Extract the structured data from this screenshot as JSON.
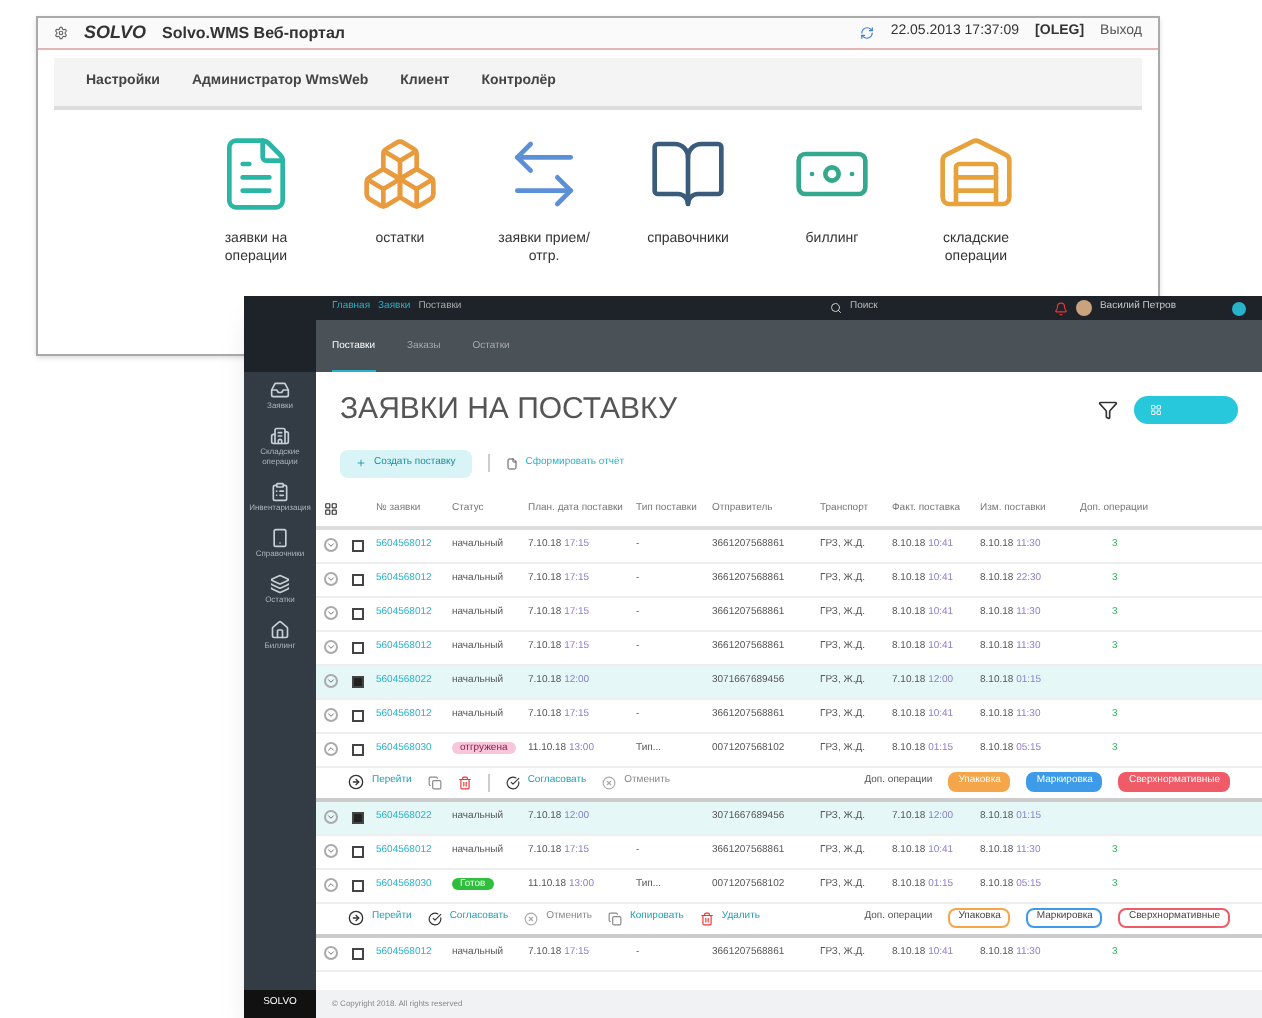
{
  "portal": {
    "logo": "SOLVO",
    "title": "Solvo.WMS Веб-портал",
    "datetime": "22.05.2013 17:37:09",
    "user": "[OLEG]",
    "logout": "Выход",
    "menu": [
      "Настройки",
      "Администратор WmsWeb",
      "Клиент",
      "Контролёр"
    ],
    "tiles": [
      {
        "label": "заявки на операции"
      },
      {
        "label": "остатки"
      },
      {
        "label": "заявки прием/отгр."
      },
      {
        "label": "справочники"
      },
      {
        "label": "биллинг"
      },
      {
        "label": "складские операции"
      }
    ]
  },
  "app": {
    "breadcrumbs": [
      "Главная",
      "Заявки",
      "Поставки"
    ],
    "search": {
      "placeholder": "Поиск"
    },
    "user": "Василий Петров",
    "sidebar": [
      {
        "label": "Заявки",
        "selected": false
      },
      {
        "label": "Складские операции",
        "selected": false
      },
      {
        "label": "Инвентаризация",
        "selected": false
      },
      {
        "label": "Справочники",
        "selected": false
      },
      {
        "label": "Остатки",
        "selected": false
      },
      {
        "label": "Биллинг",
        "selected": false
      }
    ],
    "tabs": [
      {
        "label": "Поставки",
        "selected": true
      },
      {
        "label": "Заказы",
        "selected": false
      },
      {
        "label": "Остатки",
        "selected": false
      }
    ],
    "heading": "ЗАЯВКИ НА ПОСТАВКУ",
    "create_button": "Создать поставку",
    "report_link": "Сформировать отчёт",
    "columns": [
      "№ заявки",
      "Статус",
      "План. дата поставки",
      "Тип поставки",
      "Отправитель",
      "Транспорт",
      "Факт. поставка",
      "Изм. поставки",
      "Доп. операции"
    ],
    "rows": [
      {
        "id": "5604568012",
        "status": {
          "label": "начальный"
        },
        "plan": "7.10.18",
        "plan_time": "17:15",
        "type": "-",
        "sender": "3661207568861",
        "transport": "ГРЗ, Ж.Д.",
        "fact": "8.10.18",
        "fact_time": "10:41",
        "change": "8.10.18",
        "change_time": "11:30",
        "count": "3",
        "checked": false,
        "selected": false,
        "expanded": false
      },
      {
        "id": "5604568012",
        "status": {
          "label": "начальный"
        },
        "plan": "7.10.18",
        "plan_time": "17:15",
        "type": "-",
        "sender": "3661207568861",
        "transport": "ГРЗ, Ж.Д.",
        "fact": "8.10.18",
        "fact_time": "10:41",
        "change": "8.10.18",
        "change_time": "22:30",
        "count": "3",
        "checked": false,
        "selected": false,
        "expanded": false
      },
      {
        "id": "5604568012",
        "status": {
          "label": "начальный"
        },
        "plan": "7.10.18",
        "plan_time": "17:15",
        "type": "-",
        "sender": "3661207568861",
        "transport": "ГРЗ, Ж.Д.",
        "fact": "8.10.18",
        "fact_time": "10:41",
        "change": "8.10.18",
        "change_time": "11:30",
        "count": "3",
        "checked": false,
        "selected": false,
        "expanded": false
      },
      {
        "id": "5604568012",
        "status": {
          "label": "начальный"
        },
        "plan": "7.10.18",
        "plan_time": "17:15",
        "type": "-",
        "sender": "3661207568861",
        "transport": "ГРЗ, Ж.Д.",
        "fact": "8.10.18",
        "fact_time": "10:41",
        "change": "8.10.18",
        "change_time": "11:30",
        "count": "3",
        "checked": false,
        "selected": false,
        "expanded": false
      },
      {
        "id": "5604568022",
        "status": {
          "label": "начальный"
        },
        "plan": "7.10.18",
        "plan_time": "12:00",
        "sender": "3071667689456",
        "transport": "ГРЗ, Ж.Д.",
        "fact": "7.10.18",
        "fact_time": "12:00",
        "change": "8.10.18",
        "change_time": "01:15",
        "checked": true,
        "selected": true,
        "expanded": false
      },
      {
        "id": "5604568012",
        "status": {
          "label": "начальный"
        },
        "plan": "7.10.18",
        "plan_time": "17:15",
        "type": "-",
        "sender": "3661207568861",
        "transport": "ГРЗ, Ж.Д.",
        "fact": "8.10.18",
        "fact_time": "10:41",
        "change": "8.10.18",
        "change_time": "11:30",
        "count": "3",
        "checked": false,
        "selected": false,
        "expanded": false
      },
      {
        "id": "5604568030",
        "status": {
          "label": "отгружена",
          "color": "#f7c6d9"
        },
        "plan": "11.10.18",
        "plan_time": "13:00",
        "type": "Тип...",
        "sender": "0071207568102",
        "transport": "ГРЗ, Ж.Д.",
        "fact": "8.10.18",
        "fact_time": "01:15",
        "change": "8.10.18",
        "change_time": "05:15",
        "count": "3",
        "checked": false,
        "selected": false,
        "expanded": true,
        "actions": [
          {
            "kind": "go",
            "label": "Перейти"
          },
          {
            "kind": "copy"
          },
          {
            "kind": "delete"
          },
          {
            "kind": "separator"
          },
          {
            "kind": "approve",
            "label": "Согласовать"
          },
          {
            "kind": "cancel",
            "label": "Отменить",
            "disabled": true
          }
        ],
        "ops_label": "Доп. операции",
        "ops": [
          {
            "label": "Упаковка",
            "color": "#f5a54a",
            "filled": true
          },
          {
            "label": "Маркировка",
            "color": "#3d9be9",
            "filled": true
          },
          {
            "label": "Сверхнормативные",
            "color": "#ef5b66",
            "filled": true
          }
        ]
      },
      {
        "id": "5604568022",
        "status": {
          "label": "начальный"
        },
        "plan": "7.10.18",
        "plan_time": "12:00",
        "sender": "3071667689456",
        "transport": "ГРЗ, Ж.Д.",
        "fact": "7.10.18",
        "fact_time": "12:00",
        "change": "8.10.18",
        "change_time": "01:15",
        "checked": true,
        "selected": true,
        "expanded": false
      },
      {
        "id": "5604568012",
        "status": {
          "label": "начальный"
        },
        "plan": "7.10.18",
        "plan_time": "17:15",
        "type": "-",
        "sender": "3661207568861",
        "transport": "ГРЗ, Ж.Д.",
        "fact": "8.10.18",
        "fact_time": "10:41",
        "change": "8.10.18",
        "change_time": "11:30",
        "count": "3",
        "checked": false,
        "selected": false,
        "expanded": false
      },
      {
        "id": "5604568030",
        "status": {
          "label": "Готов",
          "color": "#2fbf3c"
        },
        "plan": "11.10.18",
        "plan_time": "13:00",
        "type": "Тип...",
        "sender": "0071207568102",
        "transport": "ГРЗ, Ж.Д.",
        "fact": "8.10.18",
        "fact_time": "01:15",
        "change": "8.10.18",
        "change_time": "05:15",
        "count": "3",
        "checked": false,
        "selected": false,
        "expanded": true,
        "actions": [
          {
            "kind": "go",
            "label": "Перейти"
          },
          {
            "kind": "approve",
            "label": "Согласовать"
          },
          {
            "kind": "cancel",
            "label": "Отменить",
            "disabled": true
          },
          {
            "kind": "copy",
            "label": "Копировать"
          },
          {
            "kind": "delete",
            "label": "Удалить"
          }
        ],
        "ops_label": "Доп. операции",
        "ops": [
          {
            "label": "Упаковка",
            "color": "#f5a54a",
            "filled": false
          },
          {
            "label": "Маркировка",
            "color": "#3d9be9",
            "filled": false
          },
          {
            "label": "Сверхнормативные",
            "color": "#ef5b66",
            "filled": false
          }
        ]
      },
      {
        "id": "5604568012",
        "status": {
          "label": "начальный"
        },
        "plan": "7.10.18",
        "plan_time": "17:15",
        "type": "-",
        "sender": "3661207568861",
        "transport": "ГРЗ, Ж.Д.",
        "fact": "8.10.18",
        "fact_time": "10:41",
        "change": "8.10.18",
        "change_time": "11:30",
        "count": "3",
        "checked": false,
        "selected": false,
        "expanded": false
      }
    ],
    "footer": {
      "copyright": "© Copyright 2018. All rights reserved",
      "sidebar_logo": "SOLVO"
    }
  }
}
